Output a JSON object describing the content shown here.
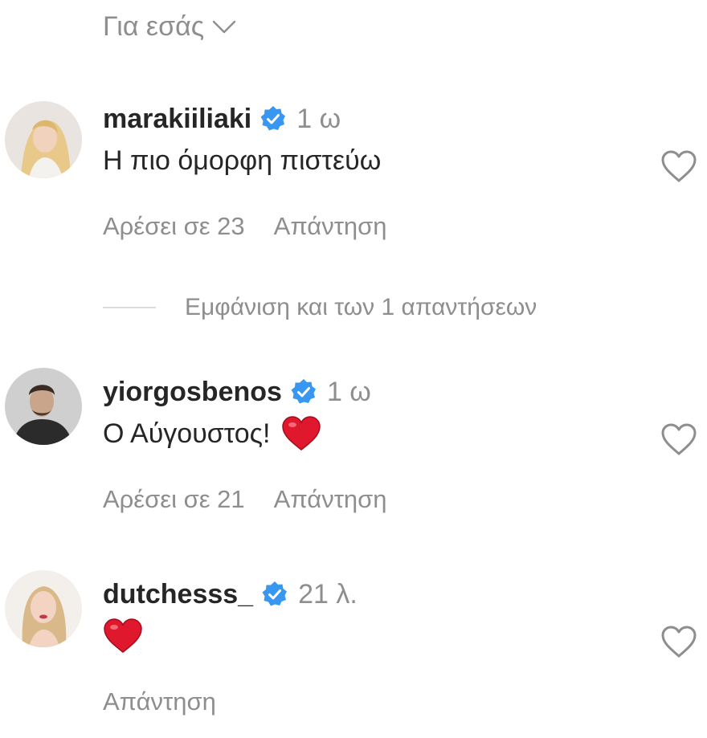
{
  "filter": {
    "label": "Για εσάς",
    "icon": "chevron-down-icon"
  },
  "comments": [
    {
      "username": "marakiiliaki",
      "verified": true,
      "time": "1 ω",
      "text": "Η πιο όμορφη πιστεύω",
      "likes": "Αρέσει σε 23",
      "reply": "Απάντηση"
    },
    {
      "username": "yiorgosbenos",
      "verified": true,
      "time": "1 ω",
      "text": "Ο Αύγουστος!",
      "emoji": "heart-emoji",
      "likes": "Αρέσει σε 21",
      "reply": "Απάντηση"
    },
    {
      "username": "dutchesss_",
      "verified": true,
      "time": "21 λ.",
      "text": "",
      "emoji": "heart-emoji",
      "reply": "Απάντηση"
    }
  ],
  "view_replies": {
    "label": "Εμφάνιση και των 1 απαντήσεων"
  },
  "colors": {
    "text": "#262626",
    "secondary": "#8e8e8e",
    "verified_blue": "#3897f0",
    "heart_red": "#e0182d",
    "divider": "#dbdbdb"
  }
}
